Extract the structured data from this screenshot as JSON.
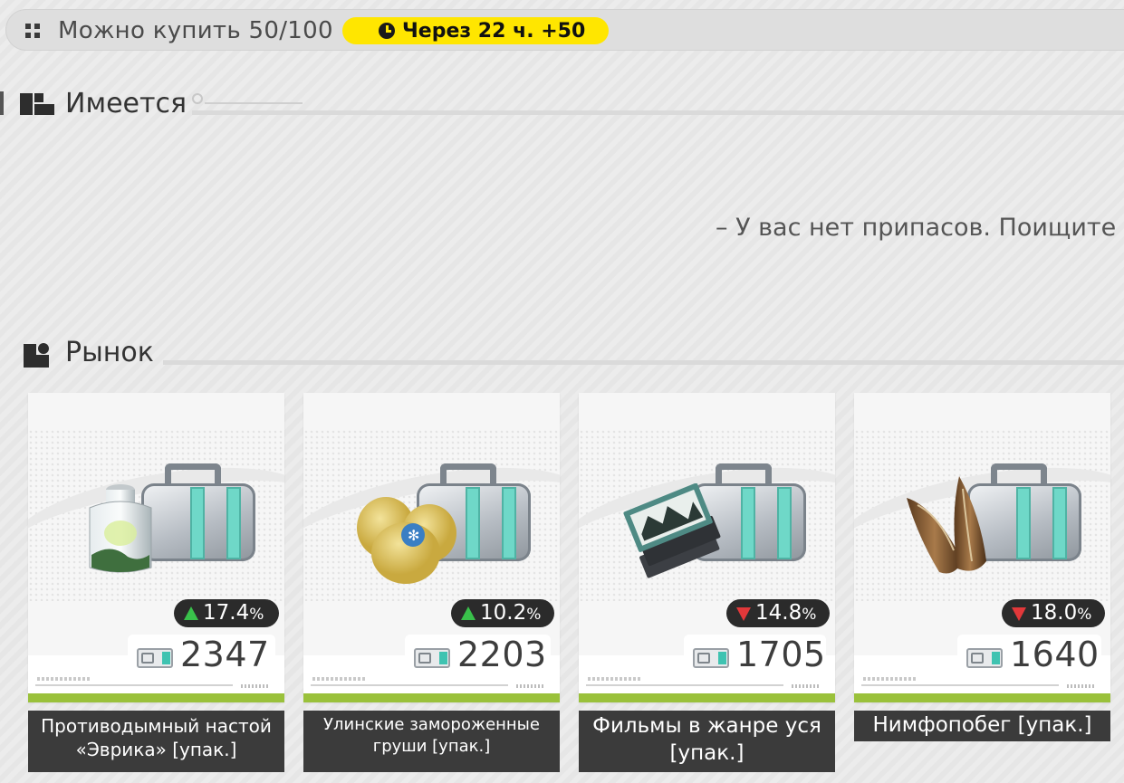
{
  "topbar": {
    "purchase_label": "Можно купить 50/100",
    "timer_label": "Через 22 ч. +50"
  },
  "owned": {
    "title": "Имеется",
    "empty_message": "– У вас нет припасов. Поищите"
  },
  "market": {
    "title": "Рынок",
    "items": [
      {
        "name": "Противодымный настой «Эврика» [упак.]",
        "change": "17.4",
        "direction": "up",
        "price": "2347"
      },
      {
        "name": "Улинские замороженные груши [упак.]",
        "change": "10.2",
        "direction": "up",
        "price": "2203"
      },
      {
        "name": "Фильмы в жанре уся [упак.]",
        "change": "14.8",
        "direction": "down",
        "price": "1705"
      },
      {
        "name": "Нимфопобег [упак.]",
        "change": "18.0",
        "direction": "down",
        "price": "1640"
      }
    ],
    "percent_sign": "%"
  },
  "colors": {
    "up": "#39c14b",
    "down": "#e2383a",
    "timer_bg": "#ffe600",
    "accent_bar": "#9ac13b"
  }
}
